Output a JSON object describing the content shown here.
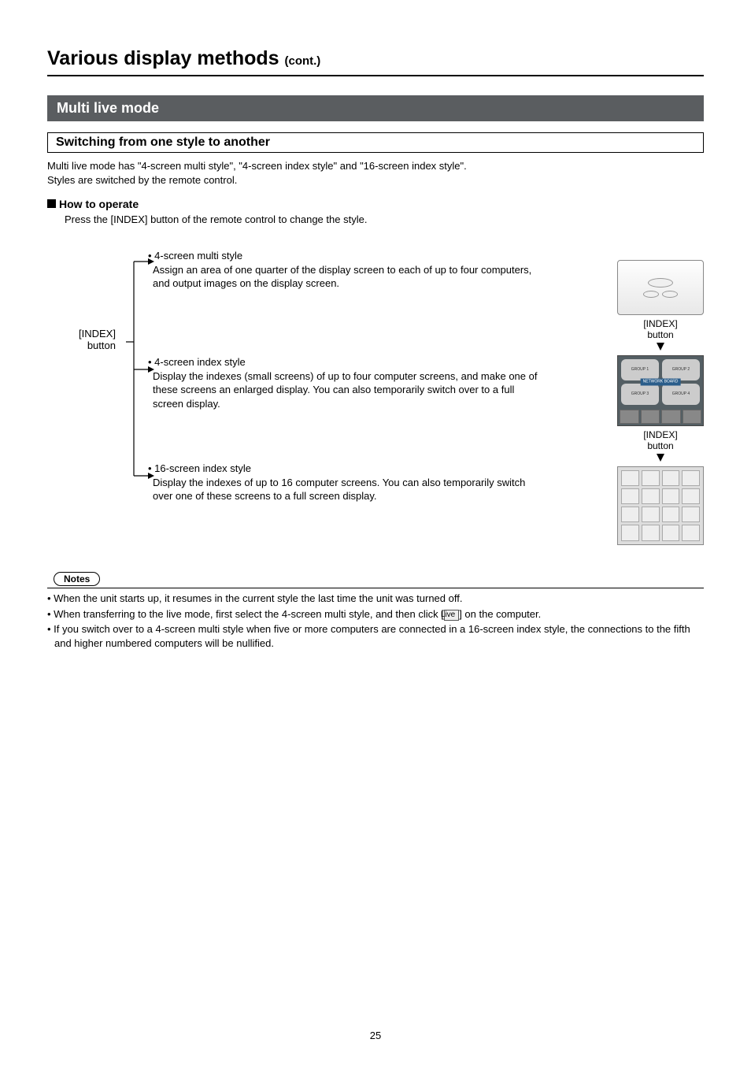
{
  "header": {
    "title": "Various display methods",
    "cont": "(cont.)"
  },
  "section": {
    "title": "Multi live mode",
    "subtitle": "Switching from one style to another",
    "intro1": "Multi live mode has \"4-screen multi style\", \"4-screen index style\" and \"16-screen index style\".",
    "intro2": "Styles are switched by the remote control."
  },
  "howto": {
    "label": "How to operate",
    "text": "Press the [INDEX] button of the remote control to change the style."
  },
  "tree": {
    "source_label1": "[INDEX]",
    "source_label2": "button",
    "styles": [
      {
        "title": "4-screen multi style",
        "desc": "Assign an area of one quarter of the display screen to each of up to four computers, and output images on the display screen."
      },
      {
        "title": "4-screen index style",
        "desc": "Display the indexes (small screens) of up to four computer screens, and make one of these screens an enlarged display. You can also temporarily switch over to a full screen display."
      },
      {
        "title": "16-screen index style",
        "desc": "Display the indexes of up to 16 computer screens. You can also temporarily switch over one of these screens to a full screen display."
      }
    ]
  },
  "right": {
    "arrow1_l1": "[INDEX]",
    "arrow1_l2": "button",
    "arrow2_l1": "[INDEX]",
    "arrow2_l2": "button",
    "grp1": "GROUP 1",
    "grp2": "GROUP 2",
    "grp3": "GROUP 3",
    "grp4": "GROUP 4",
    "nwb": "NETWORK BOARD"
  },
  "notes": {
    "label": "Notes",
    "items": [
      {
        "pre": "• When the unit starts up, it resumes in the current style the last time the unit was turned off.",
        "live": "",
        "post": ""
      },
      {
        "pre": "• When transferring to the live mode, first select the 4-screen multi style, and then click [",
        "live": "Live",
        "post": "] on the computer."
      },
      {
        "pre": "• If you switch over to a 4-screen multi style when five or more computers are connected in a 16-screen index style, the connections to the fifth and higher numbered computers will be nullified.",
        "live": "",
        "post": ""
      }
    ]
  },
  "page_number": "25"
}
